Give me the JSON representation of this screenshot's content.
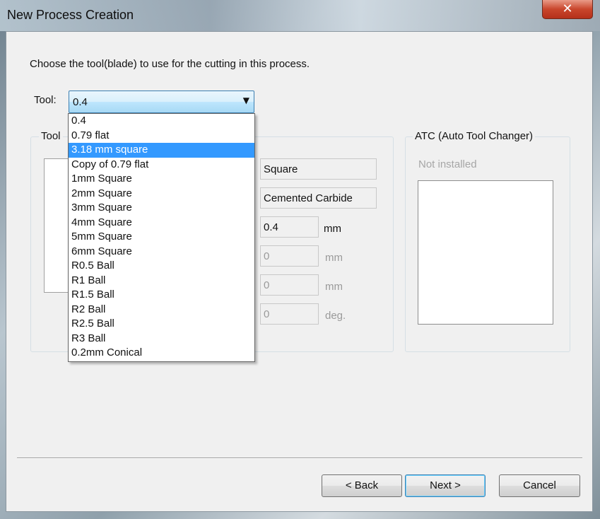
{
  "window": {
    "title": "New Process Creation",
    "close_glyph": "✕"
  },
  "instruction": "Choose the tool(blade) to use for the cutting in this process.",
  "tool_selector": {
    "label": "Tool:",
    "value": "0.4",
    "options": [
      "0.4",
      "0.79 flat",
      "3.18 mm square",
      "Copy of 0.79 flat",
      "1mm Square",
      "2mm Square",
      "3mm Square",
      "4mm Square",
      "5mm Square",
      "6mm Square",
      "R0.5 Ball",
      "R1 Ball",
      "R1.5 Ball",
      "R2 Ball",
      "R2.5 Ball",
      "R3 Ball",
      "0.2mm Conical"
    ],
    "highlighted_index": 2
  },
  "tool_group": {
    "title": "Tool",
    "shape": "Square",
    "material": "Cemented Carbide",
    "diameter": {
      "value": "0.4",
      "unit": "mm"
    },
    "field2": {
      "value": "0",
      "unit": "mm"
    },
    "field3": {
      "value": "0",
      "unit": "mm"
    },
    "angle": {
      "value": "0",
      "unit": "deg."
    }
  },
  "atc_group": {
    "title": "ATC (Auto Tool Changer)",
    "status": "Not installed"
  },
  "buttons": {
    "back": "< Back",
    "next": "Next >",
    "cancel": "Cancel"
  },
  "colors": {
    "selection": "#3399ff",
    "close_button": "#c9462c",
    "window_bg": "#f0f0f0"
  }
}
